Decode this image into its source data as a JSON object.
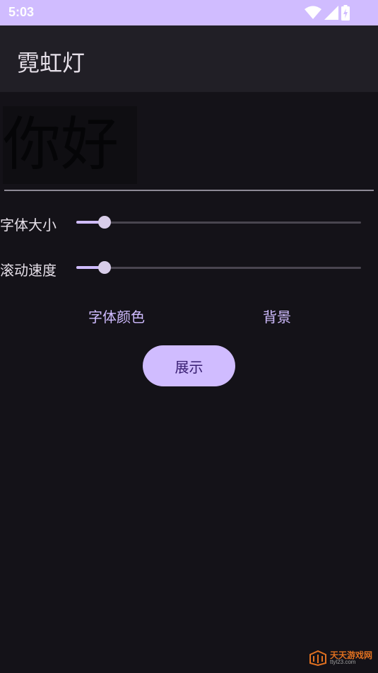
{
  "status_bar": {
    "time": "5:03",
    "icons": [
      "wifi-icon",
      "signal-icon",
      "battery-icon"
    ]
  },
  "app_bar": {
    "title": "霓虹灯"
  },
  "preview": {
    "text": "你好"
  },
  "sliders": {
    "font_size": {
      "label": "字体大小",
      "value": 0.1
    },
    "scroll_speed": {
      "label": "滚动速度",
      "value": 0.1
    }
  },
  "actions": {
    "font_color_label": "字体颜色",
    "background_label": "背景",
    "show_label": "展示"
  },
  "watermark": {
    "main": "天天游戏网",
    "sub": "ttyl23.com"
  },
  "colors": {
    "accent": "#d0bcff",
    "background": "#141218",
    "app_bar": "#211f26",
    "on_accent": "#381e72"
  }
}
